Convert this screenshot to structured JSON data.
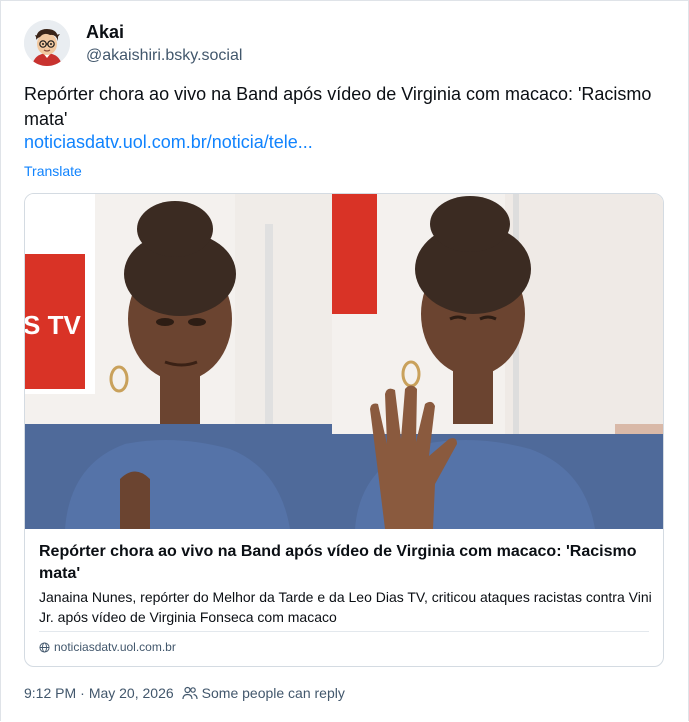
{
  "post": {
    "author_name": "Akai",
    "author_handle": "@akaishiri.bsky.social",
    "text": "Repórter chora ao vivo na Band após vídeo de Virginia com macaco: 'Racismo mata'",
    "link_text": "noticiasdatv.uol.com.br/noticia/tele...",
    "translate_label": "Translate",
    "timestamp": "9:12 PM",
    "date": "May 20, 2026",
    "reply_setting": "Some people can reply"
  },
  "card": {
    "title": "Repórter chora ao vivo na Band após vídeo de Virginia com macaco: 'Racismo mata'",
    "description": "Janaina Nunes, repórter do Melhor da Tarde e da Leo Dias TV, criticou ataques racistas contra Vini Jr. após vídeo de Virginia Fonseca com macaco",
    "domain": "noticiasdatv.uol.com.br",
    "thumbnail_overlay_text": "S TV"
  },
  "colors": {
    "link": "#1083fe",
    "muted": "#42576c",
    "border": "#d4dbe2"
  }
}
